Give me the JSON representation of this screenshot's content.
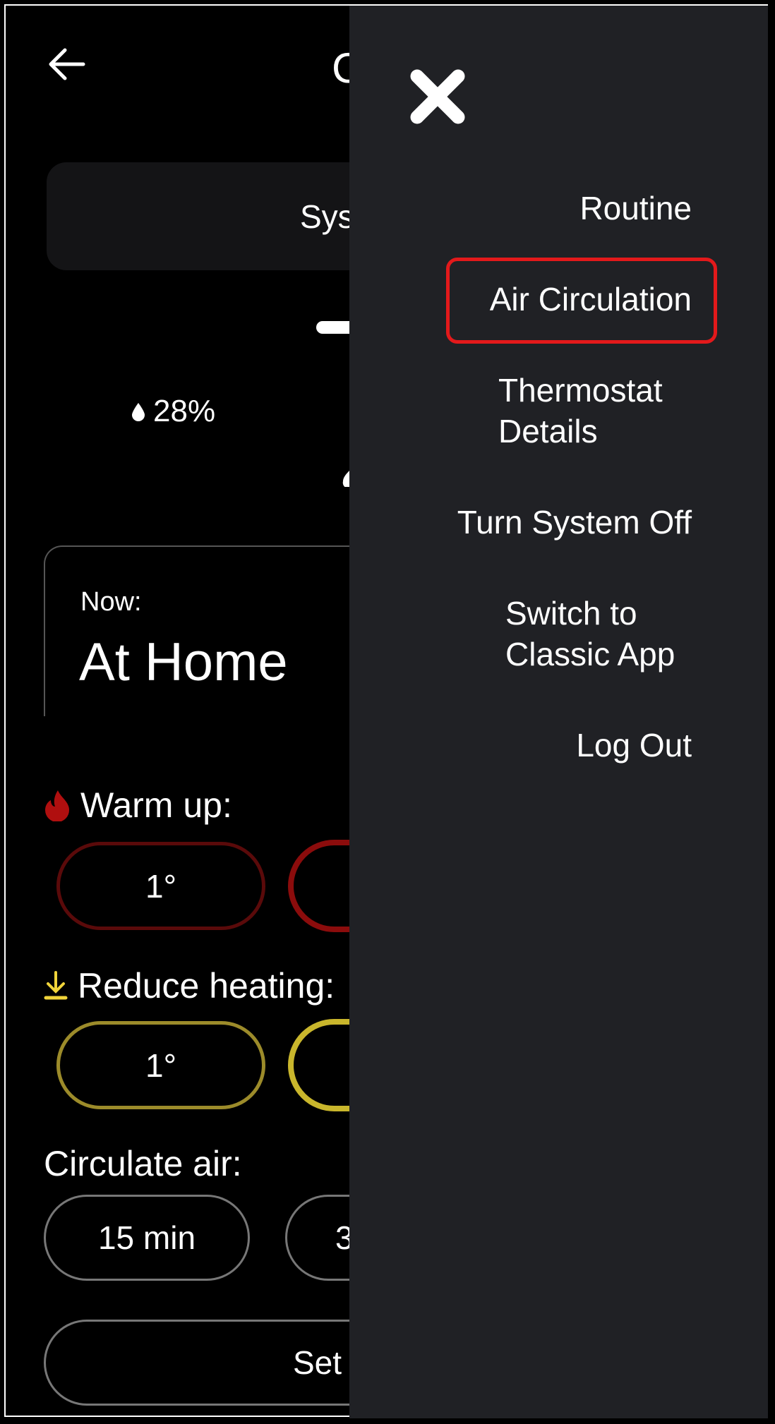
{
  "header": {
    "back_icon": "arrow-left-icon",
    "title_partial": "C"
  },
  "system_card": {
    "label_partial": "Sys"
  },
  "humidity": {
    "icon": "water-drop-icon",
    "value": "28%"
  },
  "now_card": {
    "label": "Now:",
    "value": "At Home"
  },
  "warm_up": {
    "icon": "flame-icon",
    "label": "Warm up:",
    "options": [
      "1°",
      ""
    ],
    "color": "#8b0c0c"
  },
  "reduce_heating": {
    "icon": "arrow-down-to-line-icon",
    "label": "Reduce heating:",
    "options": [
      "1°",
      ""
    ],
    "color": "#c9b62c"
  },
  "circulate_air": {
    "label": "Circulate air:",
    "options": [
      "15 min",
      "3"
    ]
  },
  "set_button": {
    "label_partial": "Set"
  },
  "menu": {
    "close_icon": "close-icon",
    "items": [
      "Routine",
      "Air Circulation",
      "Thermostat Details",
      "Turn System Off",
      "Switch to Classic App",
      "Log Out"
    ],
    "highlighted": "Air Circulation",
    "highlight_color": "#e3191b",
    "thermostat_lines": [
      "Thermostat",
      "Details"
    ],
    "switch_lines": [
      "Switch to",
      "Classic App"
    ]
  }
}
